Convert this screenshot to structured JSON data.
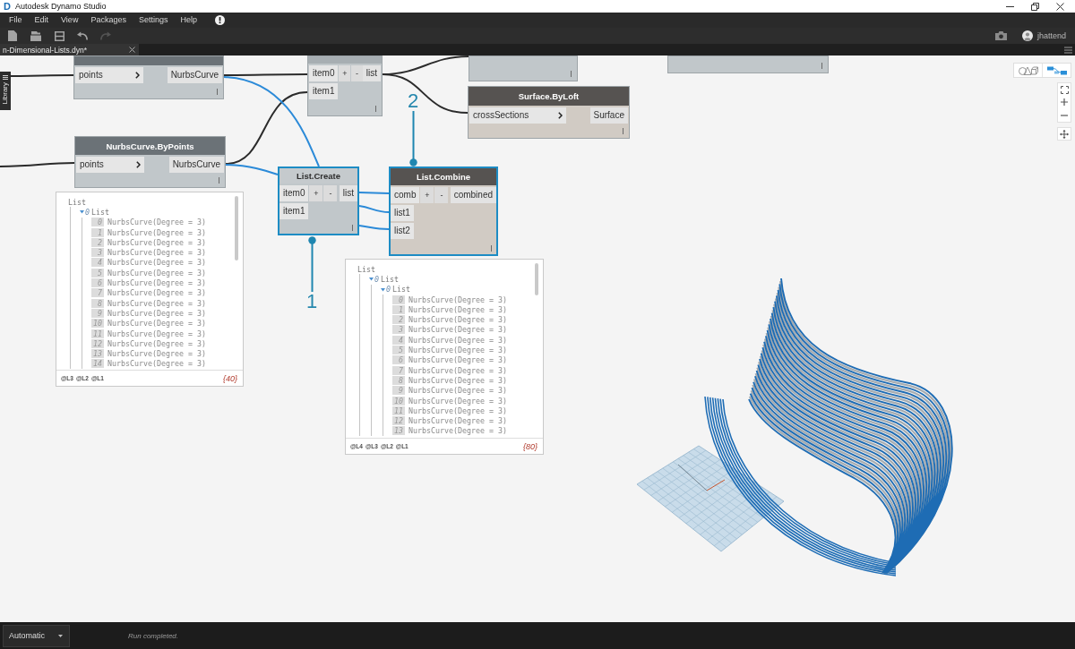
{
  "window": {
    "logo": "D",
    "title": "Autodesk Dynamo Studio"
  },
  "menu": [
    "File",
    "Edit",
    "View",
    "Packages",
    "Settings",
    "Help"
  ],
  "toolbar": [
    {
      "kind": "new",
      "disabled": false
    },
    {
      "kind": "open",
      "disabled": false
    },
    {
      "kind": "save",
      "disabled": false
    },
    {
      "kind": "undo",
      "disabled": false
    },
    {
      "kind": "redo",
      "disabled": true
    }
  ],
  "user": {
    "name": "jhattend"
  },
  "tab": {
    "title": "n-Dimensional-Lists.dyn*"
  },
  "library": {
    "label": "Library"
  },
  "view_modes": [
    {
      "kind": "geometry",
      "selected": false
    },
    {
      "kind": "graph",
      "selected": true
    }
  ],
  "nodes": [
    {
      "color": "#6b7277",
      "preview": true,
      "selected": false,
      "inputs": [
        {
          "label": "points",
          "chevron": true
        }
      ],
      "outputs": [
        {
          "label": "NurbsCurve"
        }
      ]
    },
    {
      "color": "#a7aeb2",
      "preview": true,
      "selected": false,
      "inputs": [
        {
          "label": "item0",
          "chevron": false
        },
        {
          "label": "item1",
          "chevron": false
        }
      ],
      "buttons": [
        "+",
        "-"
      ],
      "outputs": [
        {
          "label": "list"
        }
      ]
    },
    {
      "preview": true,
      "selected": false
    },
    {
      "preview": true,
      "selected": false
    },
    {
      "title": "Surface.ByLoft",
      "color": "#565351",
      "preview": false,
      "selected": false,
      "inputs": [
        {
          "label": "crossSections",
          "chevron": true
        }
      ],
      "outputs": [
        {
          "label": "Surface"
        }
      ]
    },
    {
      "title": "NurbsCurve.ByPoints",
      "color": "#6b7277",
      "preview": true,
      "selected": false,
      "inputs": [
        {
          "label": "points",
          "chevron": true
        }
      ],
      "outputs": [
        {
          "label": "NurbsCurve"
        }
      ]
    },
    {
      "title": "List.Create",
      "color": "#c5cacd",
      "preview": true,
      "selected": true,
      "inputs": [
        {
          "label": "item0",
          "chevron": false
        },
        {
          "label": "item1",
          "chevron": false
        }
      ],
      "buttons": [
        "+",
        "-"
      ],
      "outputs": [
        {
          "label": "list"
        }
      ]
    },
    {
      "title": "List.Combine",
      "color": "#565351",
      "preview": false,
      "selected": true,
      "inputs": [
        {
          "label": "comb",
          "chevron": false
        },
        {
          "label": "list1",
          "chevron": false
        },
        {
          "label": "list2",
          "chevron": false
        }
      ],
      "buttons": [
        "+",
        "-"
      ],
      "outputs": [
        {
          "label": "combined"
        }
      ]
    }
  ],
  "callouts": [
    {
      "label": "2"
    },
    {
      "label": "1"
    }
  ],
  "watches": [
    {
      "root": {
        "label": "List",
        "children": [
          {
            "index": "0",
            "label": "List",
            "expanded": true,
            "children": [
              {
                "index": "0",
                "value": "NurbsCurve(Degree = 3)"
              },
              {
                "index": "1",
                "value": "NurbsCurve(Degree = 3)"
              },
              {
                "index": "2",
                "value": "NurbsCurve(Degree = 3)"
              },
              {
                "index": "3",
                "value": "NurbsCurve(Degree = 3)"
              },
              {
                "index": "4",
                "value": "NurbsCurve(Degree = 3)"
              },
              {
                "index": "5",
                "value": "NurbsCurve(Degree = 3)"
              },
              {
                "index": "6",
                "value": "NurbsCurve(Degree = 3)"
              },
              {
                "index": "7",
                "value": "NurbsCurve(Degree = 3)"
              },
              {
                "index": "8",
                "value": "NurbsCurve(Degree = 3)"
              },
              {
                "index": "9",
                "value": "NurbsCurve(Degree = 3)"
              },
              {
                "index": "10",
                "value": "NurbsCurve(Degree = 3)"
              },
              {
                "index": "11",
                "value": "NurbsCurve(Degree = 3)"
              },
              {
                "index": "12",
                "value": "NurbsCurve(Degree = 3)"
              },
              {
                "index": "13",
                "value": "NurbsCurve(Degree = 3)"
              },
              {
                "index": "14",
                "value": "NurbsCurve(Degree = 3)"
              }
            ]
          }
        ]
      },
      "levels": [
        "@L3",
        "@L2",
        "@L1"
      ],
      "count": "{40}"
    },
    {
      "root": {
        "label": "List",
        "children": [
          {
            "index": "0",
            "label": "List",
            "expanded": true,
            "children": [
              {
                "index": "0",
                "label": "List",
                "expanded": true,
                "children": [
                  {
                    "index": "0",
                    "value": "NurbsCurve(Degree = 3)"
                  },
                  {
                    "index": "1",
                    "value": "NurbsCurve(Degree = 3)"
                  },
                  {
                    "index": "2",
                    "value": "NurbsCurve(Degree = 3)"
                  },
                  {
                    "index": "3",
                    "value": "NurbsCurve(Degree = 3)"
                  },
                  {
                    "index": "4",
                    "value": "NurbsCurve(Degree = 3)"
                  },
                  {
                    "index": "5",
                    "value": "NurbsCurve(Degree = 3)"
                  },
                  {
                    "index": "6",
                    "value": "NurbsCurve(Degree = 3)"
                  },
                  {
                    "index": "7",
                    "value": "NurbsCurve(Degree = 3)"
                  },
                  {
                    "index": "8",
                    "value": "NurbsCurve(Degree = 3)"
                  },
                  {
                    "index": "9",
                    "value": "NurbsCurve(Degree = 3)"
                  },
                  {
                    "index": "10",
                    "value": "NurbsCurve(Degree = 3)"
                  },
                  {
                    "index": "11",
                    "value": "NurbsCurve(Degree = 3)"
                  },
                  {
                    "index": "12",
                    "value": "NurbsCurve(Degree = 3)"
                  },
                  {
                    "index": "13",
                    "value": "NurbsCurve(Degree = 3)"
                  }
                ]
              }
            ]
          }
        ]
      },
      "levels": [
        "@L4",
        "@L3",
        "@L2",
        "@L1"
      ],
      "count": "{80}"
    }
  ],
  "run": {
    "mode": "Automatic",
    "status": "Run completed."
  }
}
